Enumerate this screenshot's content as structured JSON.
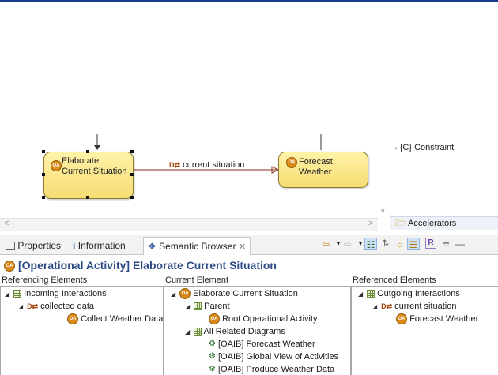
{
  "diagram": {
    "node_left_label": "Elaborate Current Situation",
    "node_right_label": "Forecast Weather",
    "edge_label": "current situation",
    "oa_badge": "OA",
    "edge_badge": "D⇄"
  },
  "palette": {
    "constraint_label": "{C} Constraint",
    "accelerators_label": "Accelerators"
  },
  "tabs": {
    "properties": "Properties",
    "information": "Information",
    "semantic_browser": "Semantic Browser"
  },
  "heading": {
    "type_prefix": "[Operational Activity]",
    "name": "Elaborate Current Situation"
  },
  "columns": {
    "referencing": "Referencing Elements",
    "current": "Current Element",
    "referenced": "Referenced Elements"
  },
  "referencing_tree": {
    "incoming": "Incoming Interactions",
    "collected": "collected data",
    "collect_weather": "Collect Weather Data"
  },
  "current_tree": {
    "root": "Elaborate Current Situation",
    "parent": "Parent",
    "root_op": "Root Operational Activity",
    "related": "All Related Diagrams",
    "d1": "[OAIB] Forecast Weather",
    "d2": "[OAIB] Global View of Activities",
    "d3": "[OAIB] Produce Weather Data"
  },
  "referenced_tree": {
    "outgoing": "Outgoing Interactions",
    "current_situation": "current situation",
    "forecast": "Forecast Weather"
  }
}
